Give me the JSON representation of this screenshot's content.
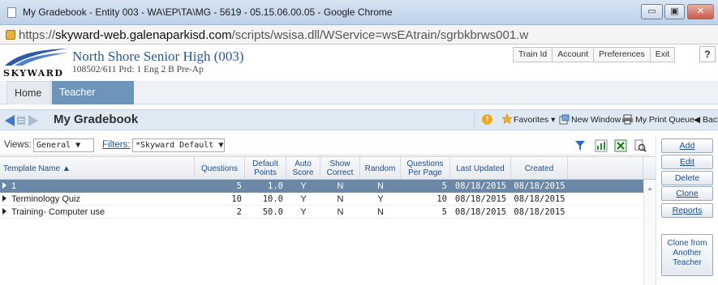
{
  "window": {
    "title": "My Gradebook - Entity 003 - WA\\EP\\TA\\MG - 5619 - 05.15.06.00.05 - Google Chrome",
    "min_label": "▭",
    "max_label": "▣",
    "close_label": "✕"
  },
  "address": {
    "scheme": "https://",
    "host": "skyward-web.galenaparkisd.com",
    "path": "/scripts/wsisa.dll/WService=wsEAtrain/sgrbkbrws001.w"
  },
  "header": {
    "logo_text": "SKYWARD",
    "school": "North Shore Senior High (003)",
    "period": "108502/611 Prd: 1 Eng 2 B Pre-Ap",
    "links": [
      "Train Id",
      "Account",
      "Preferences",
      "Exit"
    ],
    "help": "?"
  },
  "nav": {
    "tabs": [
      "Home",
      "Teacher Access"
    ]
  },
  "page": {
    "title": "My Gradebook",
    "alert": "!",
    "favorites": "Favorites",
    "new_window": "New Window",
    "print_queue": "My Print Queue",
    "back": "Back"
  },
  "toolbar": {
    "views_label": "Views:",
    "views_value": "General",
    "filters_label": "Filters:",
    "filters_value": "*Skyward Default"
  },
  "table": {
    "headers": {
      "name": "Template Name",
      "questions": "Questions",
      "default_points": "Default Points",
      "auto_score": "Auto Score",
      "show_correct": "Show Correct",
      "random": "Random",
      "per_page": "Questions Per Page",
      "last_updated": "Last Updated",
      "created": "Created"
    },
    "rows": [
      {
        "name": "1",
        "questions": "5",
        "points": "1.0",
        "auto": "Y",
        "show": "N",
        "random": "N",
        "per_page": "5",
        "updated": "08/18/2015",
        "created": "08/18/2015"
      },
      {
        "name": "Terminology Quiz",
        "questions": "10",
        "points": "10.0",
        "auto": "Y",
        "show": "N",
        "random": "Y",
        "per_page": "10",
        "updated": "08/18/2015",
        "created": "08/18/2015"
      },
      {
        "name": "Training- Computer use",
        "questions": "2",
        "points": "50.0",
        "auto": "Y",
        "show": "N",
        "random": "N",
        "per_page": "5",
        "updated": "08/18/2015",
        "created": "08/18/2015"
      }
    ]
  },
  "actions": {
    "add": "Add",
    "edit": "Edit",
    "delete": "Delete",
    "clone": "Clone",
    "reports": "Reports",
    "clone_other": "Clone from Another Teacher"
  },
  "colors": {
    "selected_row": "#6b88a6",
    "active_tab": "#6d95ba",
    "link": "#1f4e8a"
  }
}
